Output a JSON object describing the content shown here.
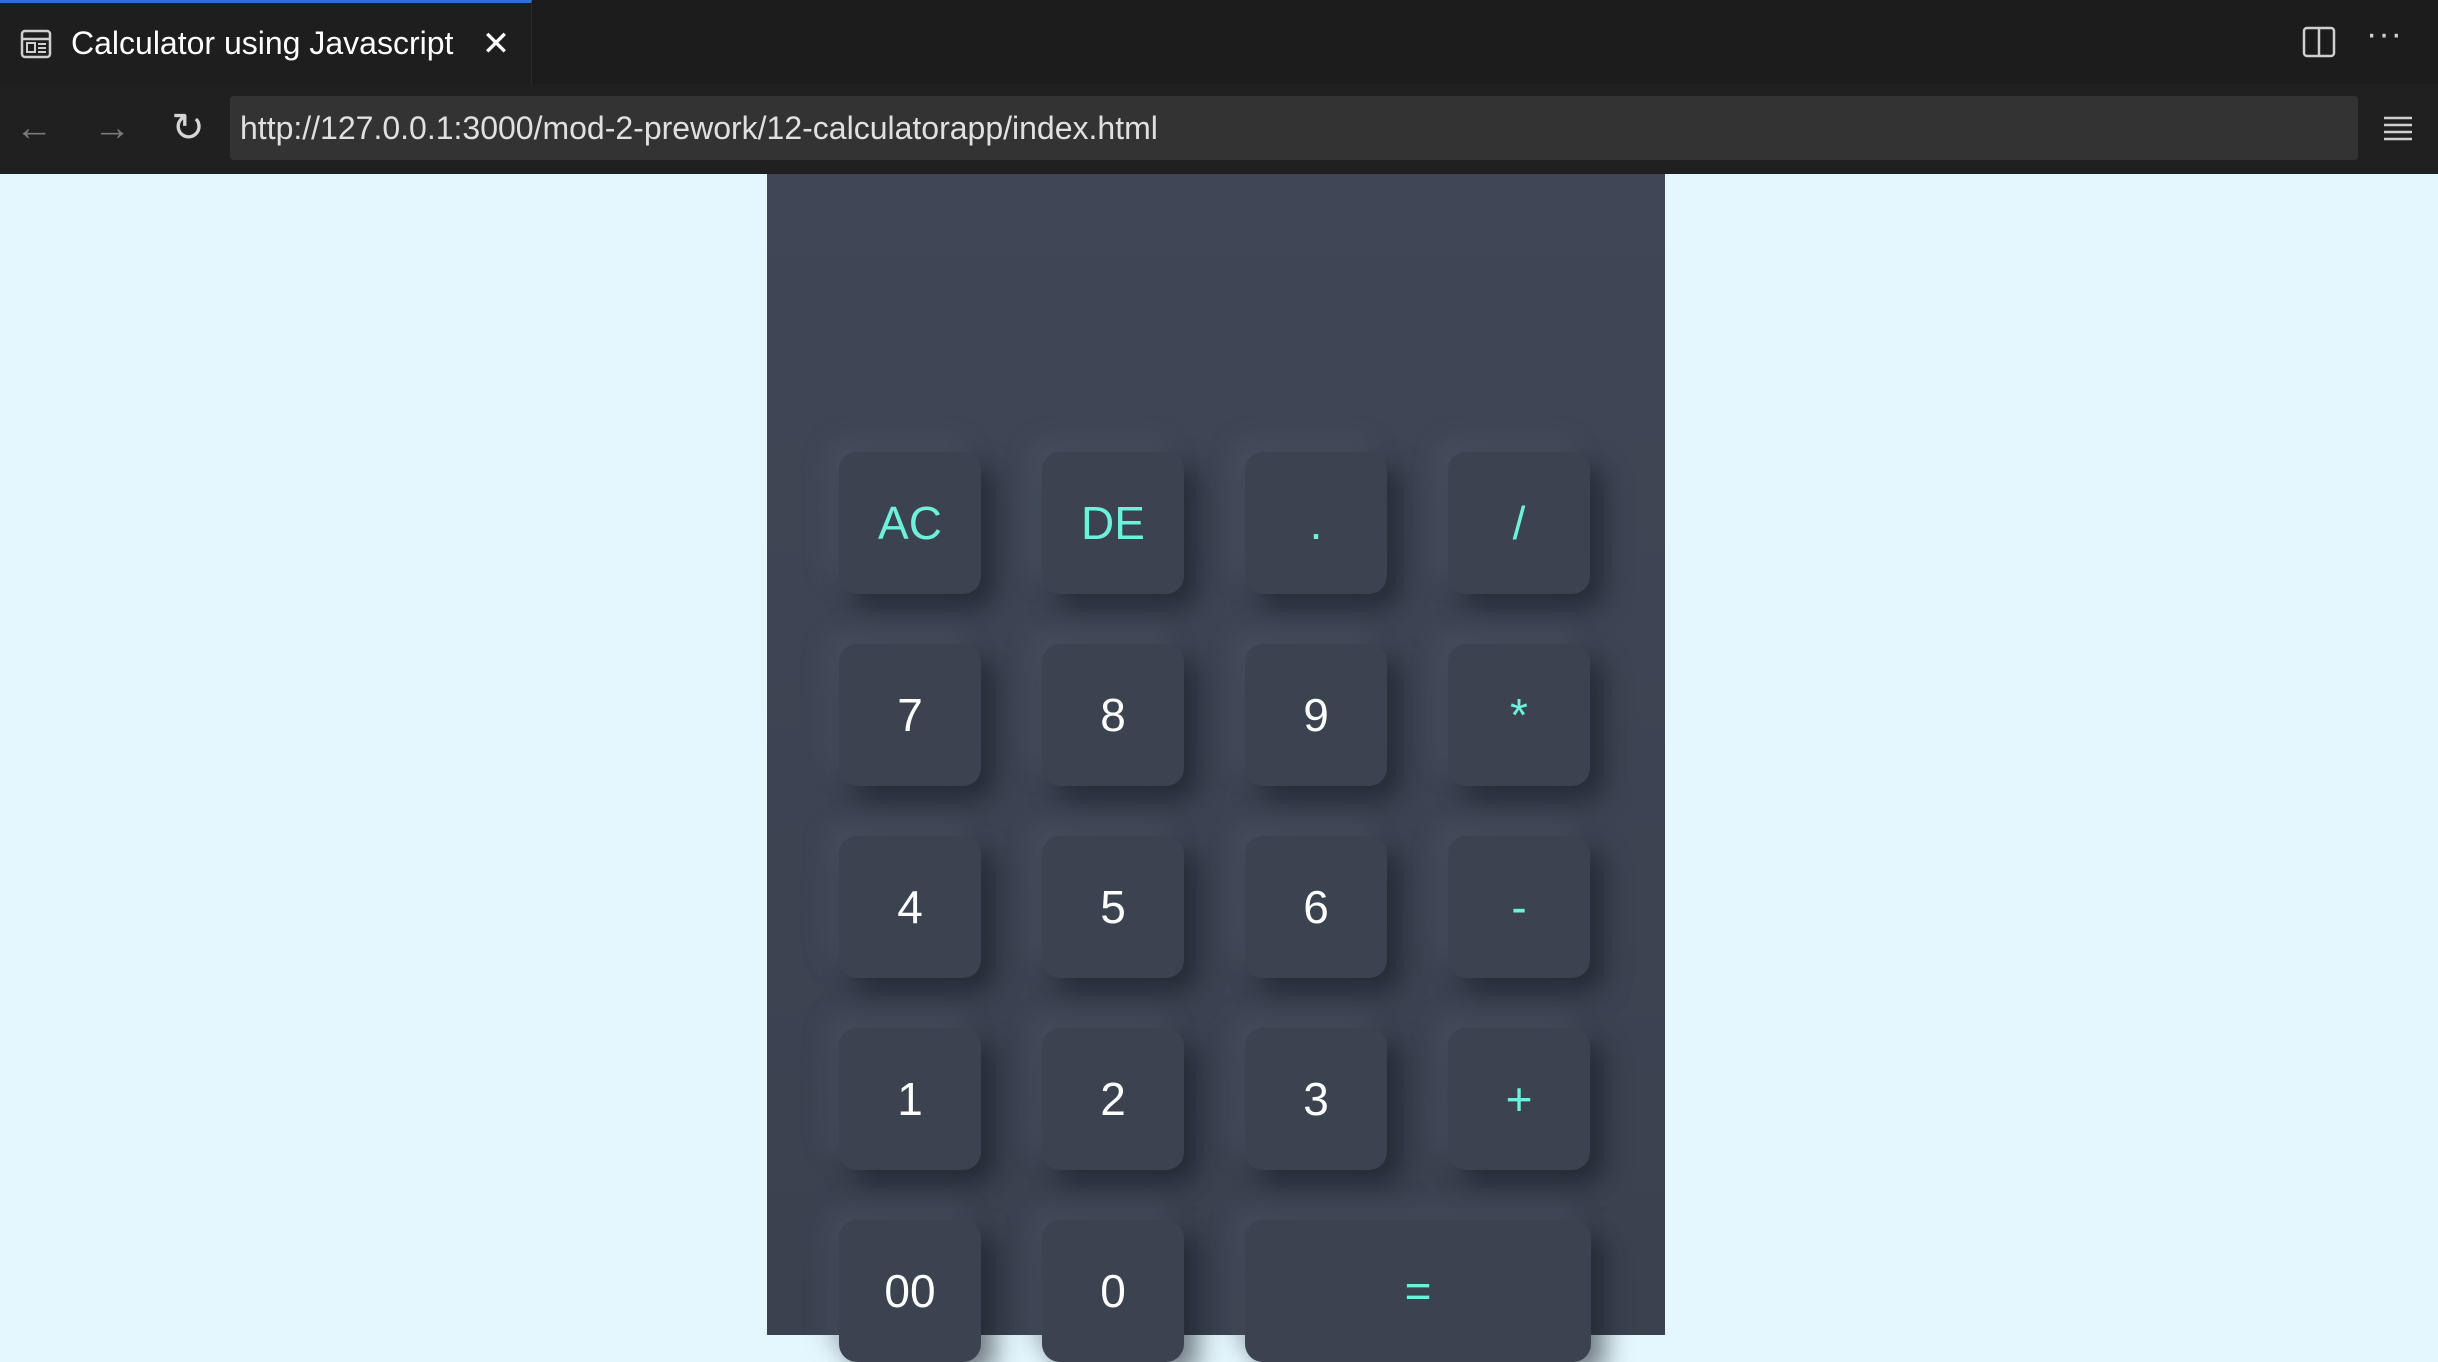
{
  "browser": {
    "tab_title": "Calculator using Javascript",
    "url": "http://127.0.0.1:3000/mod-2-prework/12-calculatorapp/index.html",
    "icons": {
      "tab": "page-icon",
      "close": "close-icon",
      "split": "split-editor-icon",
      "more": "more-icon",
      "back": "back-arrow-icon",
      "forward": "forward-arrow-icon",
      "reload": "reload-icon",
      "menu": "menu-icon"
    }
  },
  "calculator": {
    "accent_color": "#6ef0da",
    "display": "",
    "rows": [
      [
        "AC",
        "DE",
        ".",
        "/"
      ],
      [
        "7",
        "8",
        "9",
        "*"
      ],
      [
        "4",
        "5",
        "6",
        "-"
      ],
      [
        "1",
        "2",
        "3",
        "+"
      ],
      [
        "00",
        "0",
        "="
      ]
    ]
  }
}
